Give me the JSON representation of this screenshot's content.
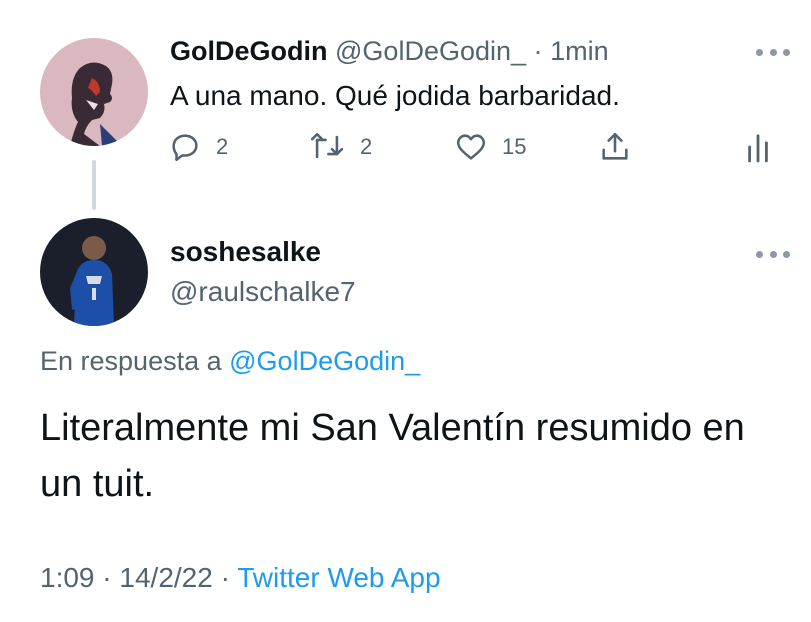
{
  "original_tweet": {
    "author_name": "GolDeGodin",
    "author_handle": "@GolDeGodin_",
    "separator": "·",
    "time": "1min",
    "text": "A una mano. Qué jodida barbaridad.",
    "actions": {
      "reply_count": "2",
      "retweet_count": "2",
      "like_count": "15",
      "icons": [
        "reply-icon",
        "retweet-icon",
        "like-icon",
        "share-icon",
        "analytics-icon"
      ]
    }
  },
  "reply_tweet": {
    "author_name": "soshesalke",
    "author_handle": "@raulschalke7",
    "replying_prefix": "En respuesta a",
    "replying_to": "@GolDeGodin_",
    "text": "Literalmente mi San Valentín resumido en un tuit.",
    "time": "1:09",
    "sep1": "·",
    "date": "14/2/22",
    "sep2": "·",
    "source": "Twitter Web App"
  },
  "colors": {
    "text_primary": "#0f1419",
    "text_secondary": "#536471",
    "link": "#1d9bf0",
    "thread_line": "#cfd9de",
    "avatar1_bg": "#d9b8c0",
    "avatar2_bg": "#1a1f2b"
  }
}
